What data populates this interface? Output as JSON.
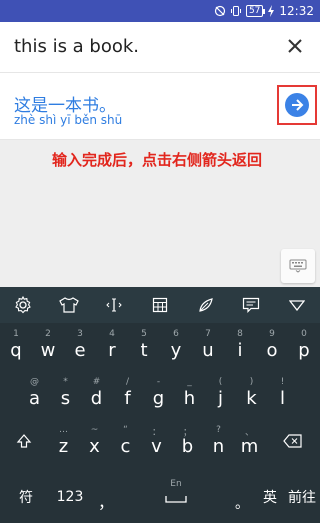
{
  "status_bar": {
    "battery": "57",
    "time": "12:32"
  },
  "input": {
    "value": "this is a book."
  },
  "result": {
    "text": "这是一本书。",
    "pinyin": "zhè shì yī běn shū"
  },
  "annotation": "输入完成后，点击右侧箭头返回",
  "keyboard": {
    "row1": [
      {
        "main": "q",
        "sub": "1"
      },
      {
        "main": "w",
        "sub": "2"
      },
      {
        "main": "e",
        "sub": "3"
      },
      {
        "main": "r",
        "sub": "4"
      },
      {
        "main": "t",
        "sub": "5"
      },
      {
        "main": "y",
        "sub": "6"
      },
      {
        "main": "u",
        "sub": "7"
      },
      {
        "main": "i",
        "sub": "8"
      },
      {
        "main": "o",
        "sub": "9"
      },
      {
        "main": "p",
        "sub": "0"
      }
    ],
    "row2": [
      {
        "main": "a",
        "sub": "@"
      },
      {
        "main": "s",
        "sub": "*"
      },
      {
        "main": "d",
        "sub": "#"
      },
      {
        "main": "f",
        "sub": "/"
      },
      {
        "main": "g",
        "sub": "-"
      },
      {
        "main": "h",
        "sub": "_"
      },
      {
        "main": "j",
        "sub": "("
      },
      {
        "main": "k",
        "sub": ")"
      },
      {
        "main": "l",
        "sub": "!"
      }
    ],
    "row3": [
      {
        "main": "z",
        "sub": "…"
      },
      {
        "main": "x",
        "sub": "~"
      },
      {
        "main": "c",
        "sub": "“"
      },
      {
        "main": "v",
        "sub": "："
      },
      {
        "main": "b",
        "sub": "；"
      },
      {
        "main": "n",
        "sub": "?"
      },
      {
        "main": "m",
        "sub": "、"
      }
    ],
    "bottom": {
      "symbols": "符",
      "numbers": "123",
      "comma": "，",
      "comma_sub": "",
      "space_sub": "En",
      "period": "。",
      "lang": "英",
      "next": "前往"
    }
  }
}
